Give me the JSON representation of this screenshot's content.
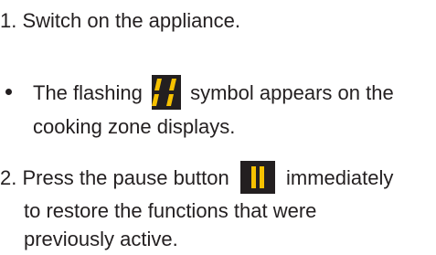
{
  "steps": [
    {
      "number": "1.",
      "text": "Switch on the appliance."
    },
    {
      "number": "2.",
      "text_before": "Press the pause button",
      "text_after": "immediately",
      "continuation_1": "to restore the functions that were",
      "continuation_2": "previously active."
    }
  ],
  "note": {
    "text_before": "The flashing",
    "text_after": "symbol appears on the",
    "continuation": "cooking zone displays."
  },
  "icons": {
    "display_symbol": "display-segment-icon",
    "pause_symbol": "pause-icon"
  }
}
